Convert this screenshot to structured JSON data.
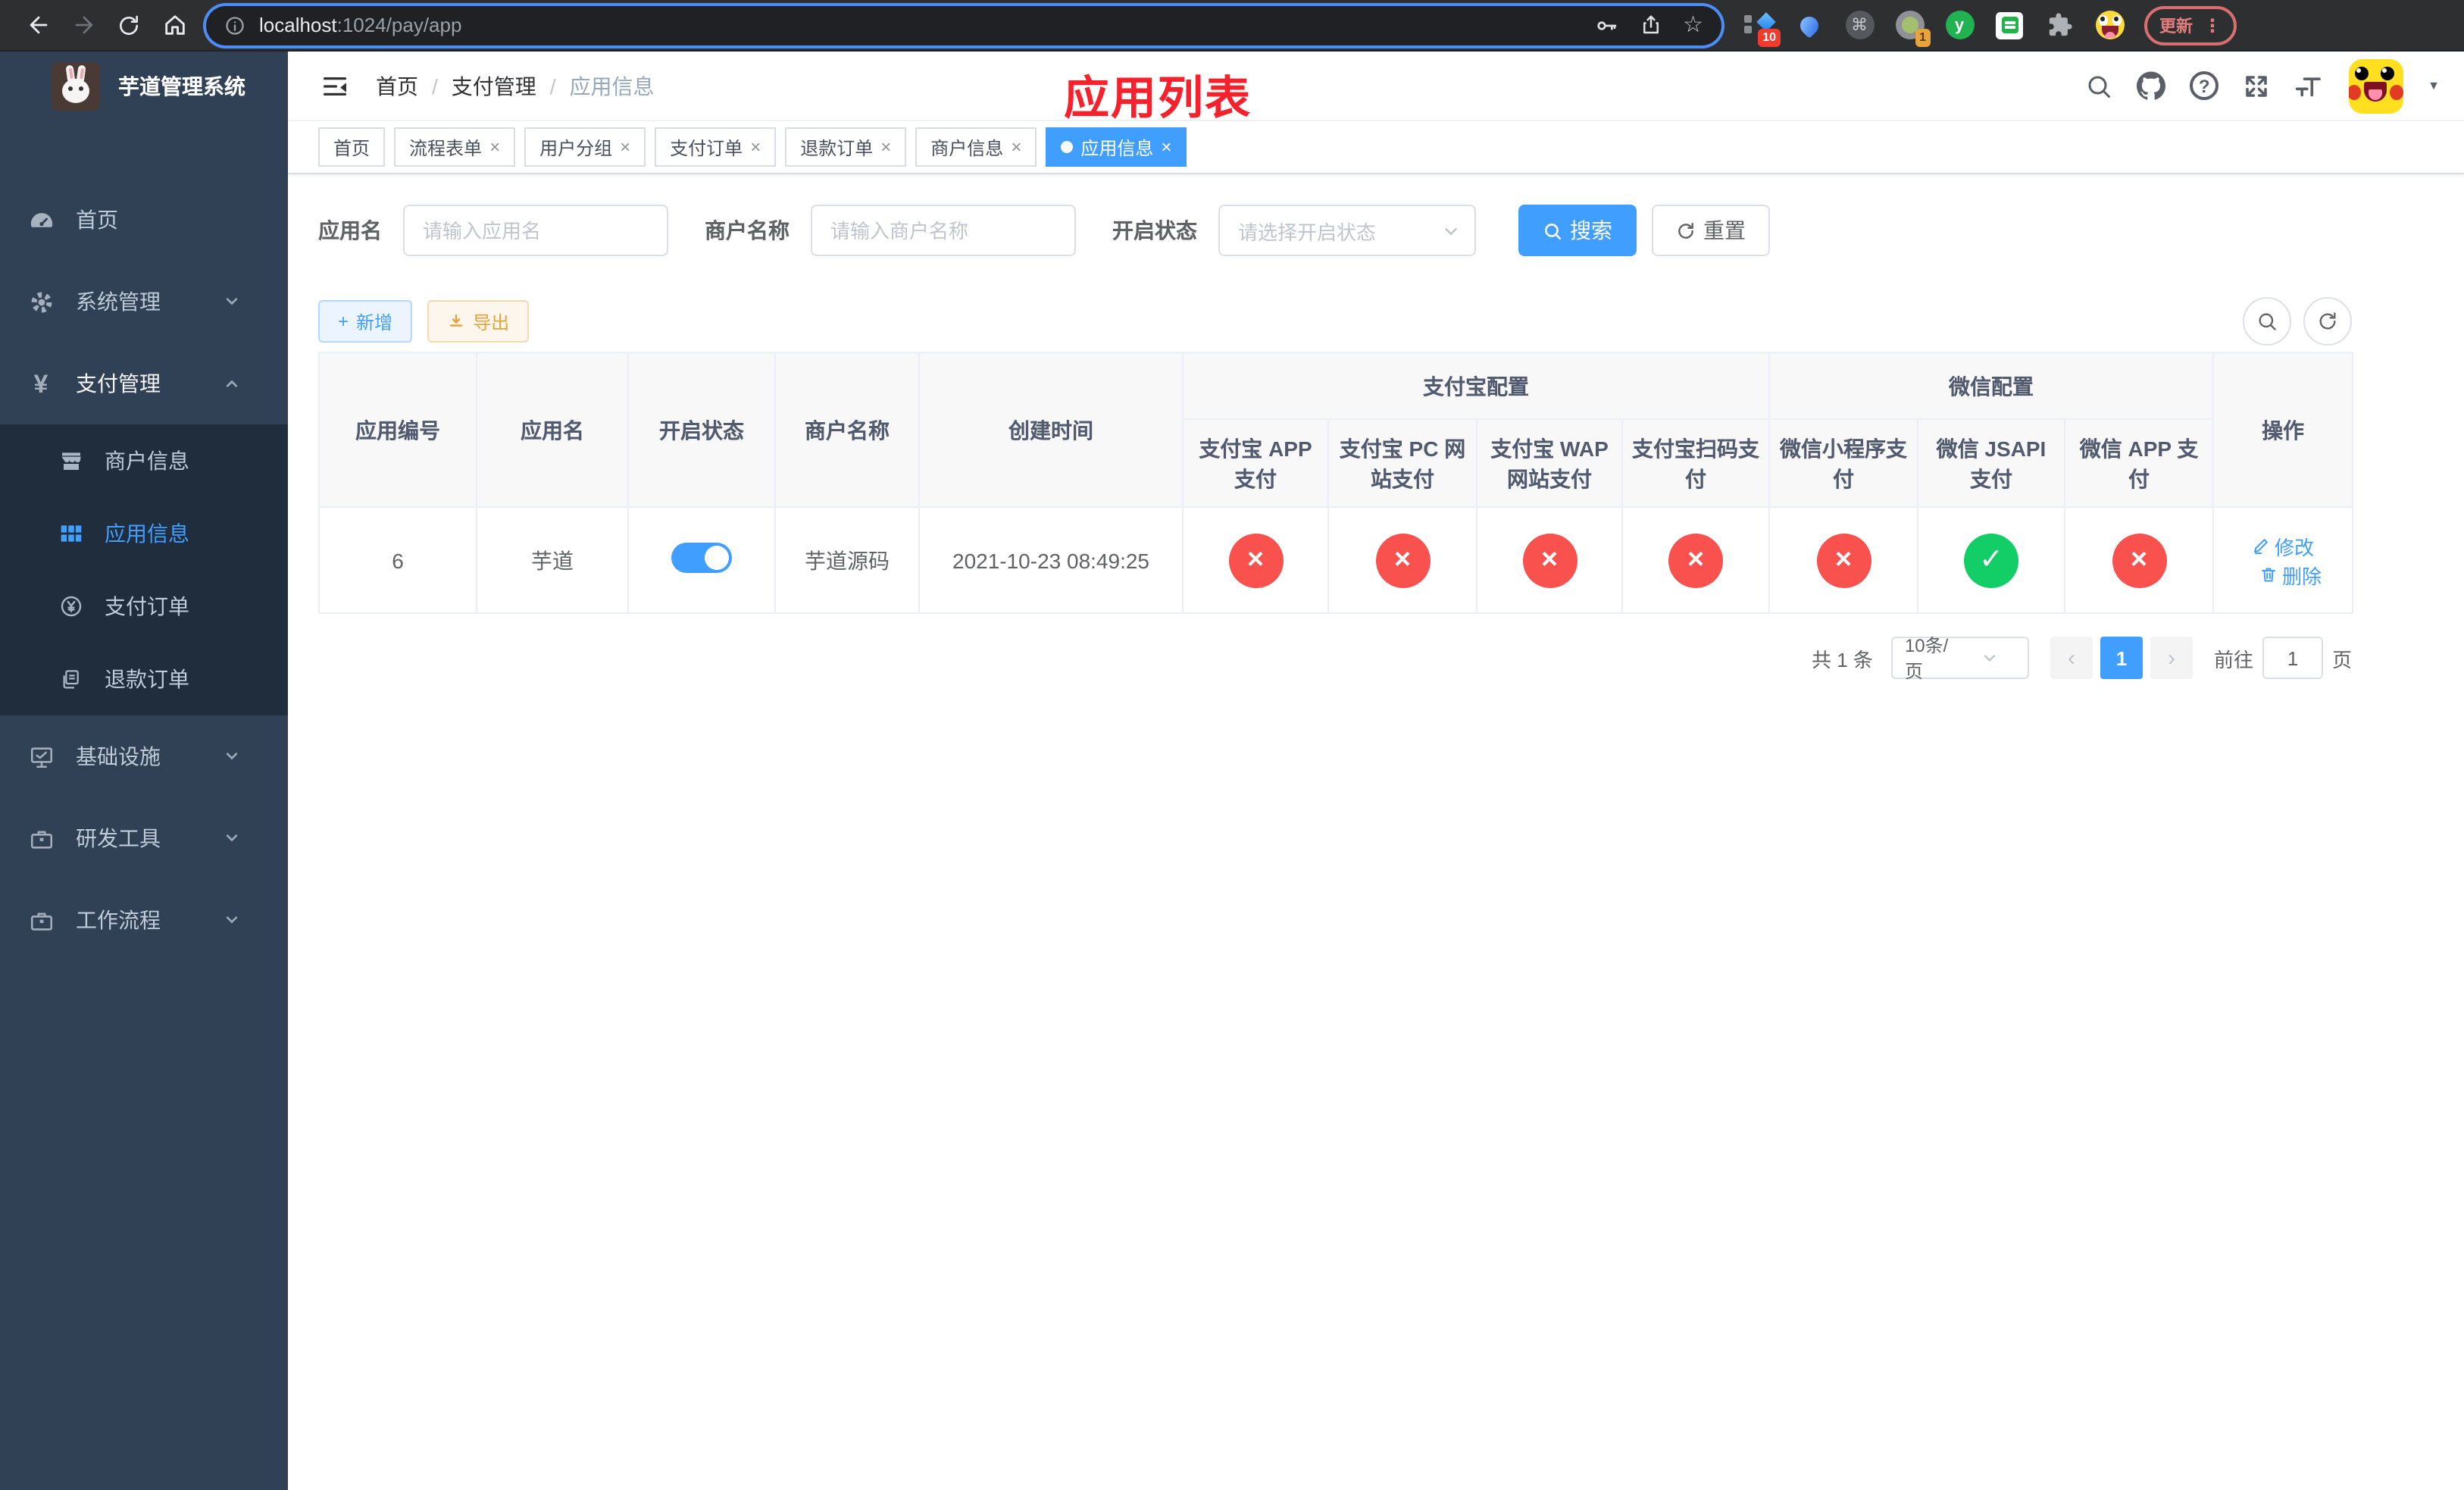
{
  "ui": {
    "close": "×",
    "prev": "‹",
    "next": "›",
    "sep": "/",
    "plus": "+",
    "check": "✓",
    "cross": "×",
    "caret": "▼",
    "dots": "⋮",
    "cmd": "⌘",
    "question": "?",
    "yen": "¥",
    "star": "☆"
  },
  "colors": {
    "accent": "#409eff",
    "success": "#13ce66",
    "danger": "#f9524e",
    "warning": "#e6a23c",
    "page_title_red": "#f5222d",
    "sidebar_bg": "#304156",
    "submenu_bg": "#1f2d3d"
  },
  "browser": {
    "url_host": "localhost",
    "url_rest": ":1024/pay/app",
    "update_label": "更新",
    "ext_badge_blocks": "10",
    "ext_badge_ring": "1",
    "ext_letter_y": "y"
  },
  "sidebar": {
    "title": "芋道管理系统",
    "home": "首页",
    "system": "系统管理",
    "payment": "支付管理",
    "sub_merchant": "商户信息",
    "sub_app": "应用信息",
    "sub_order": "支付订单",
    "sub_refund": "退款订单",
    "infra": "基础设施",
    "devtools": "研发工具",
    "workflow": "工作流程"
  },
  "header": {
    "breadcrumb": [
      "首页",
      "支付管理",
      "应用信息"
    ],
    "page_title": "应用列表"
  },
  "tabs": [
    {
      "label": "首页",
      "closable": false,
      "active": false
    },
    {
      "label": "流程表单",
      "closable": true,
      "active": false
    },
    {
      "label": "用户分组",
      "closable": true,
      "active": false
    },
    {
      "label": "支付订单",
      "closable": true,
      "active": false
    },
    {
      "label": "退款订单",
      "closable": true,
      "active": false
    },
    {
      "label": "商户信息",
      "closable": true,
      "active": false
    },
    {
      "label": "应用信息",
      "closable": true,
      "active": true
    }
  ],
  "filters": {
    "app_name_label": "应用名",
    "app_name_placeholder": "请输入应用名",
    "merchant_label": "商户名称",
    "merchant_placeholder": "请输入商户名称",
    "status_label": "开启状态",
    "status_placeholder": "请选择开启状态",
    "search_button": "搜索",
    "reset_button": "重置"
  },
  "toolbar": {
    "add_button": "新增",
    "export_button": "导出"
  },
  "table": {
    "col_app_id": "应用编号",
    "col_app_name": "应用名",
    "col_status": "开启状态",
    "col_merchant": "商户名称",
    "col_created": "创建时间",
    "group_alipay": "支付宝配置",
    "group_wechat": "微信配置",
    "col_alipay_app": "支付宝 APP 支付",
    "col_alipay_pc": "支付宝 PC 网站支付",
    "col_alipay_wap": "支付宝 WAP 网站支付",
    "col_alipay_qr": "支付宝扫码支付",
    "col_wx_mini": "微信小程序支付",
    "col_wx_jsapi": "微信 JSAPI 支付",
    "col_wx_app": "微信 APP 支付",
    "col_ops": "操作",
    "rows": [
      {
        "id": "6",
        "name": "芋道",
        "enabled": true,
        "merchant": "芋道源码",
        "created": "2021-10-23 08:49:25",
        "channels": [
          false,
          false,
          false,
          false,
          false,
          true,
          false
        ],
        "edit_label": "修改",
        "delete_label": "删除"
      }
    ]
  },
  "pagination": {
    "total": "共 1 条",
    "page_size": "10条/页",
    "current_page": "1",
    "goto_label": "前往",
    "goto_value": "1",
    "unit_label": "页"
  }
}
